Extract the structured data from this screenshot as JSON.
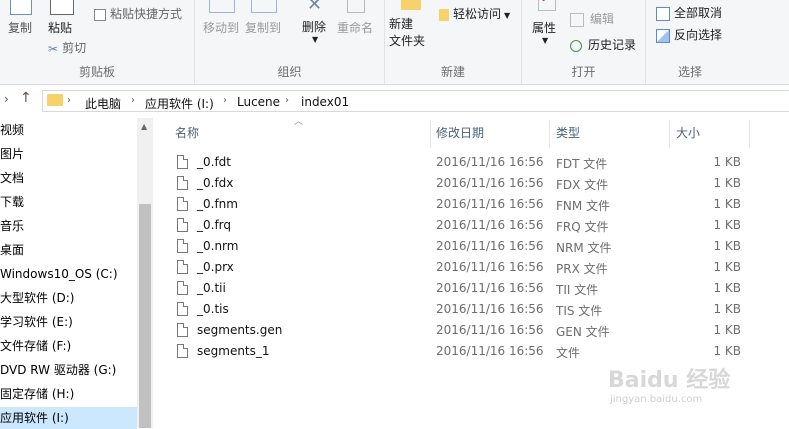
{
  "ribbon": {
    "clipboard": {
      "label": "剪贴板",
      "copy": "复制",
      "paste": "粘贴",
      "paste_shortcut": "粘贴快捷方式",
      "cut": "剪切"
    },
    "organize": {
      "label": "组织",
      "move_to": "移动到",
      "copy_to": "复制到",
      "delete": "删除",
      "rename": "重命名"
    },
    "new": {
      "label": "新建",
      "new_folder": "新建\n文件夹",
      "easy_access": "轻松访问"
    },
    "open": {
      "label": "打开",
      "properties": "属性",
      "edit": "编辑",
      "history": "历史记录"
    },
    "select": {
      "label": "选择",
      "select_none": "全部取消",
      "invert": "反向选择"
    }
  },
  "address": {
    "crumbs": [
      "此电脑",
      "应用软件 (I:)",
      "Lucene",
      "index01"
    ]
  },
  "nav": {
    "items": [
      "视频",
      "图片",
      "文档",
      "下载",
      "音乐",
      "桌面",
      "Windows10_OS (C:)",
      "大型软件 (D:)",
      "学习软件 (E:)",
      "文件存储 (F:)",
      "DVD RW 驱动器 (G:)",
      "固定存储 (H:)",
      "应用软件 (I:)"
    ],
    "selected_index": 12
  },
  "columns": {
    "name": "名称",
    "date": "修改日期",
    "type": "类型",
    "size": "大小"
  },
  "files": [
    {
      "name": "_0.fdt",
      "date": "2016/11/16 16:56",
      "type": "FDT 文件",
      "size": "1 KB"
    },
    {
      "name": "_0.fdx",
      "date": "2016/11/16 16:56",
      "type": "FDX 文件",
      "size": "1 KB"
    },
    {
      "name": "_0.fnm",
      "date": "2016/11/16 16:56",
      "type": "FNM 文件",
      "size": "1 KB"
    },
    {
      "name": "_0.frq",
      "date": "2016/11/16 16:56",
      "type": "FRQ 文件",
      "size": "1 KB"
    },
    {
      "name": "_0.nrm",
      "date": "2016/11/16 16:56",
      "type": "NRM 文件",
      "size": "1 KB"
    },
    {
      "name": "_0.prx",
      "date": "2016/11/16 16:56",
      "type": "PRX 文件",
      "size": "1 KB"
    },
    {
      "name": "_0.tii",
      "date": "2016/11/16 16:56",
      "type": "TII 文件",
      "size": "1 KB"
    },
    {
      "name": "_0.tis",
      "date": "2016/11/16 16:56",
      "type": "TIS 文件",
      "size": "1 KB"
    },
    {
      "name": "segments.gen",
      "date": "2016/11/16 16:56",
      "type": "GEN 文件",
      "size": "1 KB"
    },
    {
      "name": "segments_1",
      "date": "2016/11/16 16:56",
      "type": "文件",
      "size": "1 KB"
    }
  ],
  "watermark": {
    "main": "Baidu 经验",
    "sub": "jingyan.baidu.com"
  }
}
